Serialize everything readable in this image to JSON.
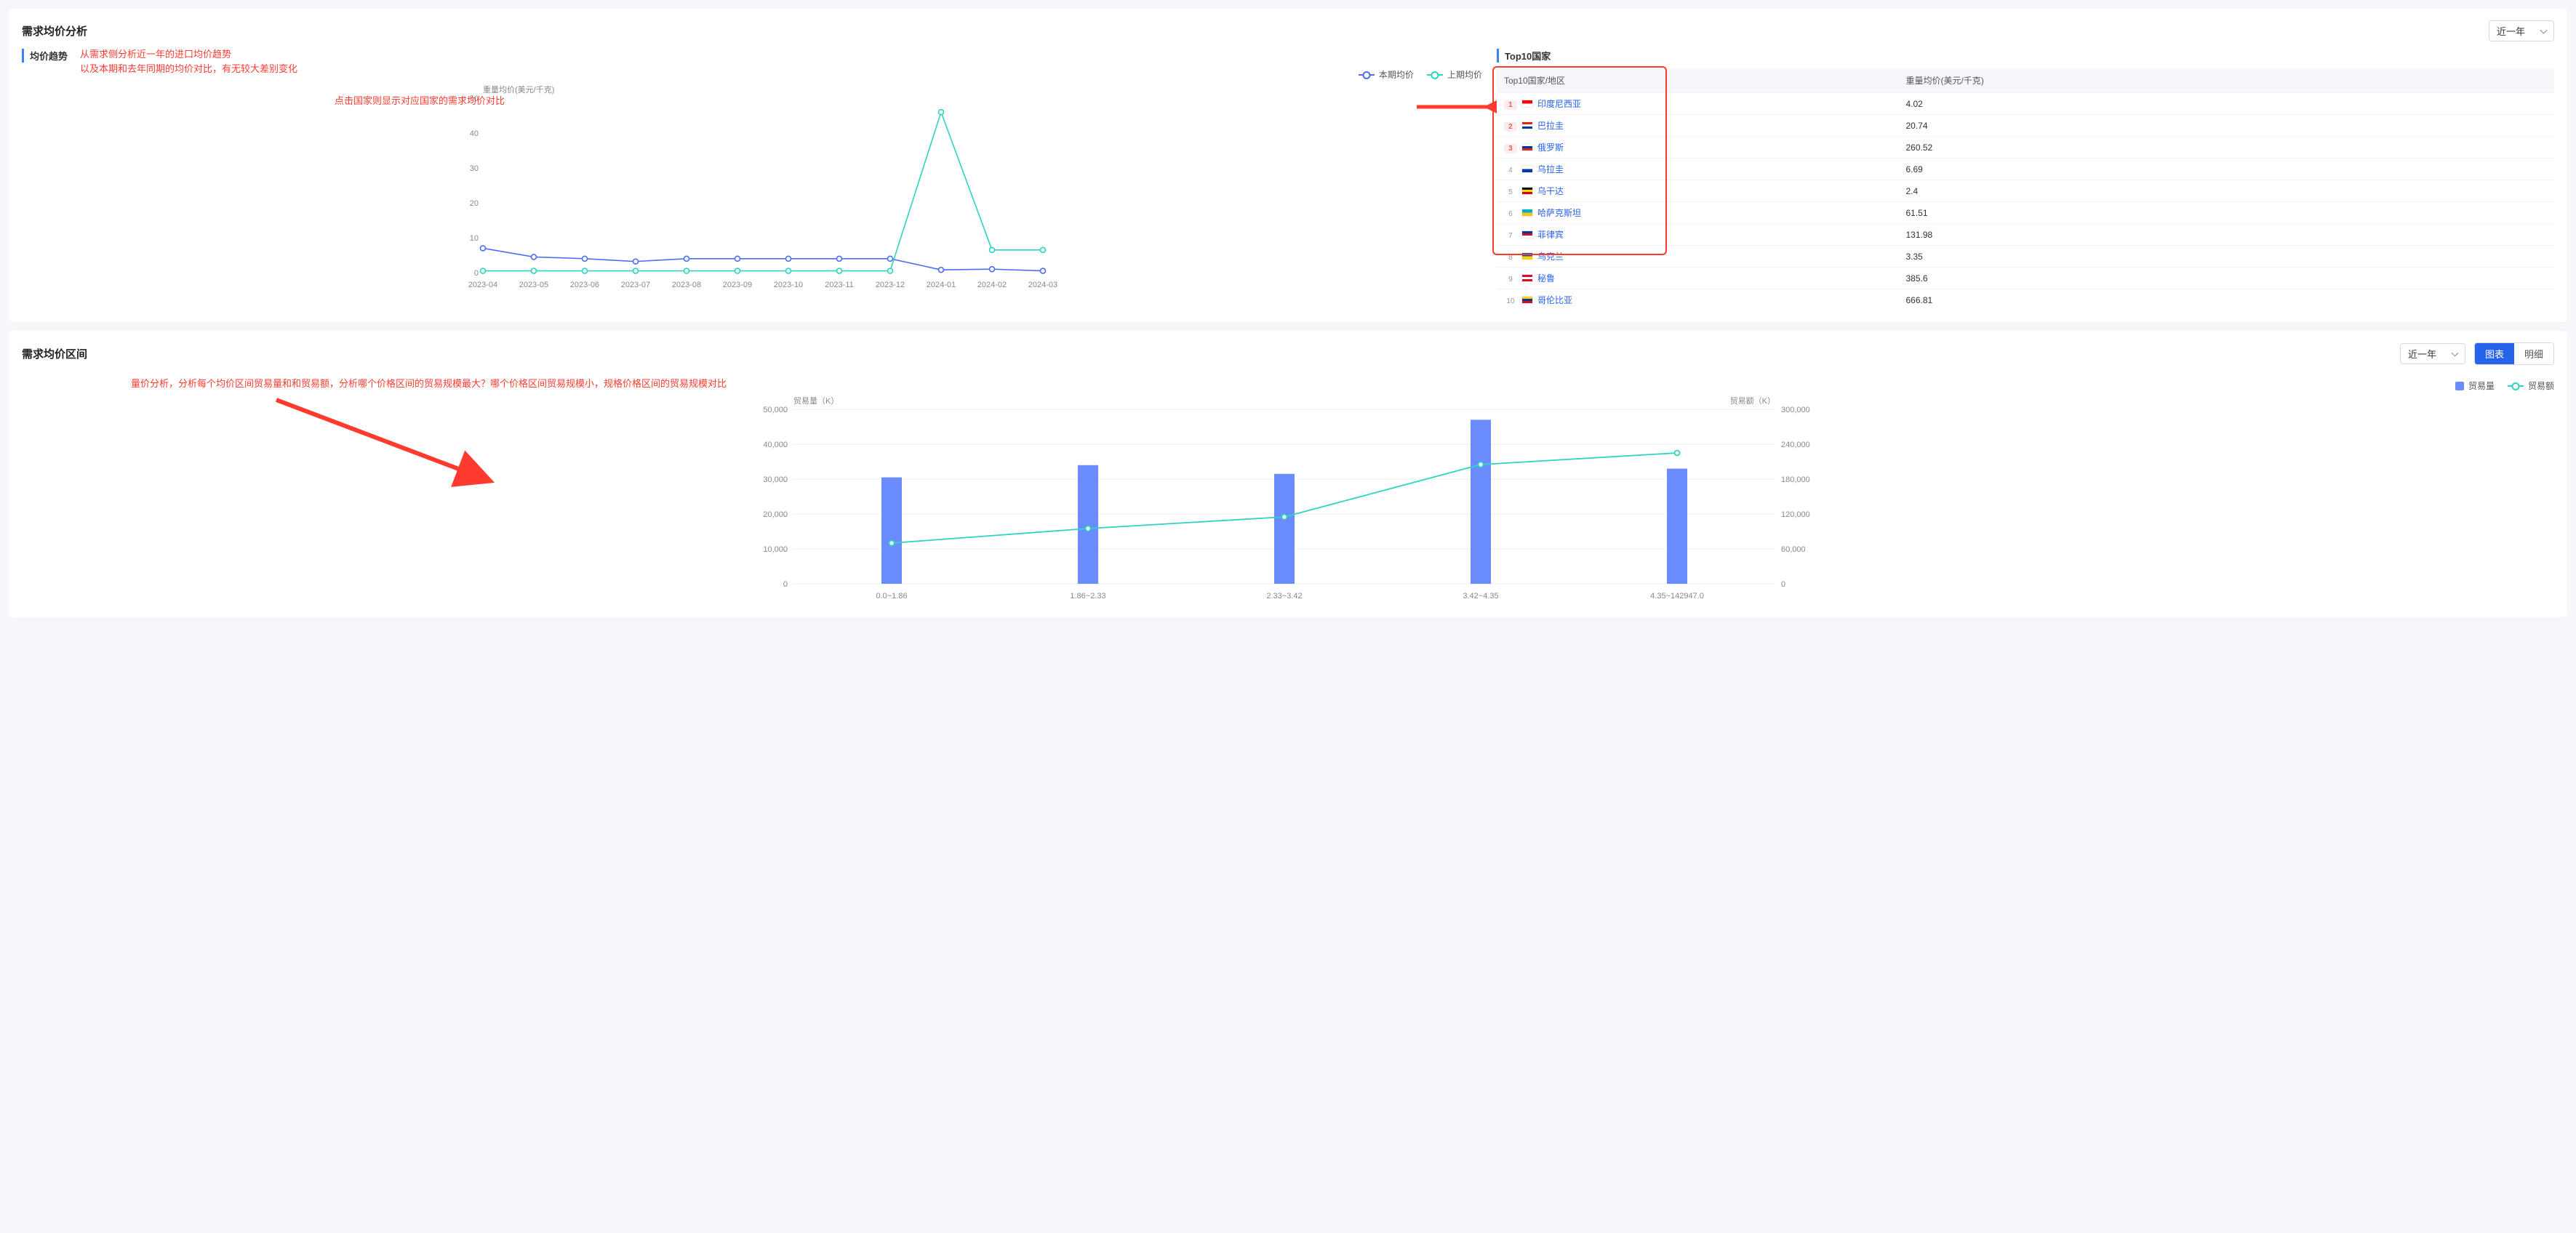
{
  "panel1": {
    "title": "需求均价分析",
    "period": "近一年",
    "sub_trend": "均价趋势",
    "sub_top10": "Top10国家",
    "annot1": "从需求侧分析近一年的进口均价趋势\n以及本期和去年同期的均价对比，有无较大差别变化",
    "annot2": "点击国家则显示对应国家的需求均价对比",
    "legend_current": "本期均价",
    "legend_prev": "上期均价",
    "yaxis_title": "重量均价(美元/千克)",
    "table": {
      "col1": "Top10国家/地区",
      "col2": "重量均价(美元/千克)",
      "rows": [
        {
          "rank": 1,
          "name": "印度尼西亚",
          "val": "4.02",
          "flag": "#ff0000,#ffffff"
        },
        {
          "rank": 2,
          "name": "巴拉圭",
          "val": "20.74",
          "flag": "#d52b1e,#ffffff,#0038a8"
        },
        {
          "rank": 3,
          "name": "俄罗斯",
          "val": "260.52",
          "flag": "#ffffff,#0033a0,#da291c"
        },
        {
          "rank": 4,
          "name": "乌拉圭",
          "val": "6.69",
          "flag": "#ffffff,#0038a8"
        },
        {
          "rank": 5,
          "name": "乌干达",
          "val": "2.4",
          "flag": "#000000,#fcdc04,#d90000"
        },
        {
          "rank": 6,
          "name": "哈萨克斯坦",
          "val": "61.51",
          "flag": "#00afca,#fec50c"
        },
        {
          "rank": 7,
          "name": "菲律宾",
          "val": "131.98",
          "flag": "#0038a8,#ce1126,#ffffff"
        },
        {
          "rank": 8,
          "name": "乌克兰",
          "val": "3.35",
          "flag": "#005bbb,#ffd500"
        },
        {
          "rank": 9,
          "name": "秘鲁",
          "val": "385.6",
          "flag": "#d91023,#ffffff,#d91023"
        },
        {
          "rank": 10,
          "name": "哥伦比亚",
          "val": "666.81",
          "flag": "#fcd116,#003893,#ce1126"
        }
      ]
    }
  },
  "panel2": {
    "title": "需求均价区间",
    "period": "近一年",
    "btn_chart": "图表",
    "btn_detail": "明细",
    "annot": "量价分析，分析每个均价区间贸易量和和贸易额，分析哪个价格区间的贸易规模最大？哪个价格区间贸易规模小，规格价格区间的贸易规模对比",
    "legend_vol": "贸易量",
    "legend_amt": "贸易额",
    "yaxis_left": "贸易量（K）",
    "yaxis_right": "贸易额（K）"
  },
  "chart_data": [
    {
      "type": "line",
      "title": "均价趋势",
      "xlabel": "",
      "ylabel": "重量均价(美元/千克)",
      "ylim": [
        0,
        50
      ],
      "categories": [
        "2023-04",
        "2023-05",
        "2023-06",
        "2023-07",
        "2023-08",
        "2023-09",
        "2023-10",
        "2023-11",
        "2023-12",
        "2024-01",
        "2024-02",
        "2024-03"
      ],
      "series": [
        {
          "name": "本期均价",
          "color": "#4e6ef2",
          "values": [
            7,
            4.5,
            4,
            3.2,
            4,
            4,
            4,
            4,
            4,
            0.8,
            1,
            0.5
          ]
        },
        {
          "name": "上期均价",
          "color": "#2dd4bf",
          "values": [
            0.5,
            0.5,
            0.5,
            0.5,
            0.5,
            0.5,
            0.5,
            0.5,
            0.5,
            46,
            6.5,
            6.5
          ]
        }
      ]
    },
    {
      "type": "bar",
      "title": "需求均价区间",
      "categories": [
        "0.0~1.86",
        "1.86~2.33",
        "2.33~3.42",
        "3.42~4.35",
        "4.35~142947.0"
      ],
      "ylim_left": [
        0,
        50000
      ],
      "ylim_right": [
        0,
        300000
      ],
      "yaxis_left": "贸易量（K）",
      "yaxis_right": "贸易额（K）",
      "series": [
        {
          "name": "贸易量",
          "kind": "bar",
          "color": "#6a8cff",
          "values": [
            30500,
            34000,
            31500,
            47000,
            33000
          ]
        },
        {
          "name": "贸易额",
          "kind": "line",
          "color": "#2dd4bf",
          "values": [
            70000,
            95000,
            115000,
            205000,
            225000
          ]
        }
      ]
    }
  ]
}
